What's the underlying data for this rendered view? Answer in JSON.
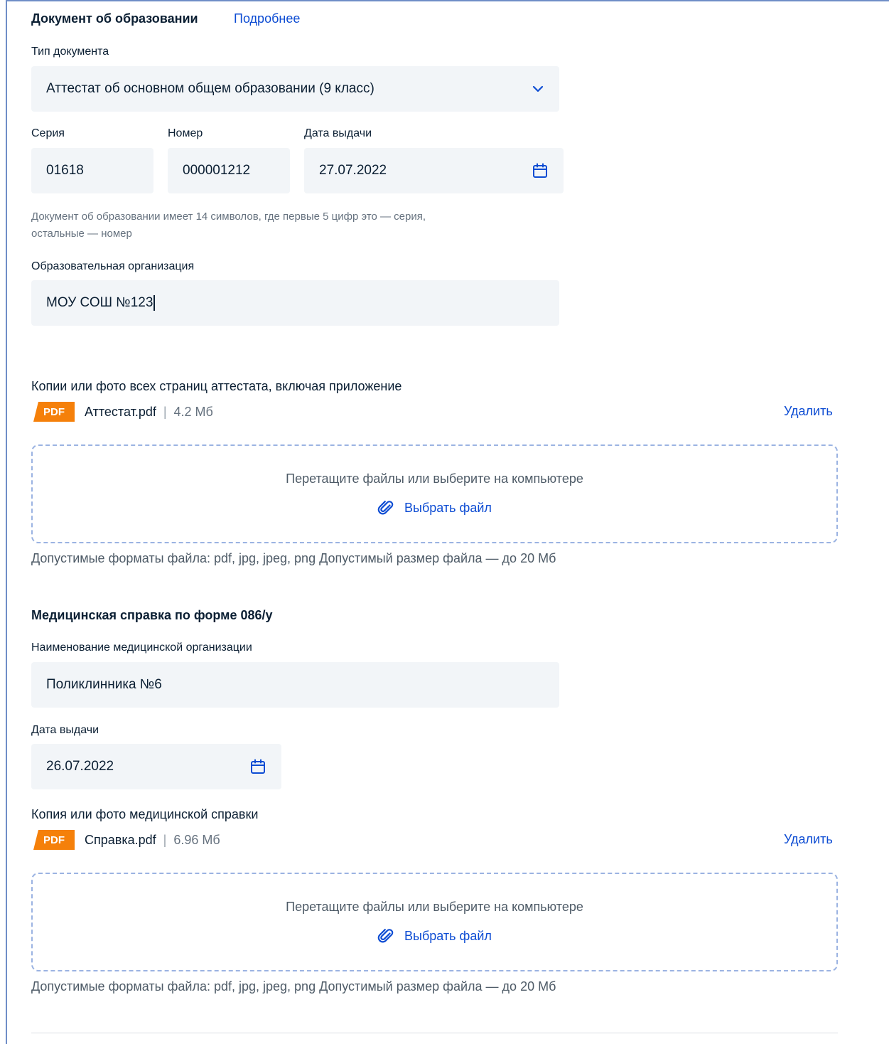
{
  "edu": {
    "title": "Документ об образовании",
    "more_link": "Подробнее",
    "doc_type_label": "Тип документа",
    "doc_type_value": "Аттестат об основном общем образовании (9 класс)",
    "series_label": "Серия",
    "series_value": "01618",
    "number_label": "Номер",
    "number_value": "000001212",
    "issue_date_label": "Дата выдачи",
    "issue_date_value": "27.07.2022",
    "hint_line1": "Документ об образовании имеет 14 символов, где первые 5 цифр это — серия,",
    "hint_line2": "остальные — номер",
    "org_label": "Образовательная организация",
    "org_value": "МОУ СОШ №123",
    "copies_label": "Копии или фото всех страниц аттестата, включая приложение",
    "file": {
      "badge": "PDF",
      "name": "Аттестат.pdf",
      "separator": "|",
      "size": "4.2 Мб",
      "delete": "Удалить"
    },
    "dropzone": {
      "text": "Перетащите файлы или выберите на компьютере",
      "choose": "Выбрать файл"
    },
    "formats": "Допустимые форматы файла: pdf, jpg, jpeg, png Допустимый размер файла — до 20 Мб"
  },
  "med": {
    "title": "Медицинская справка по форме 086/у",
    "org_label": "Наименование медицинской организации",
    "org_value": "Поликлинника №6",
    "issue_date_label": "Дата выдачи",
    "issue_date_value": "26.07.2022",
    "copy_label": "Копия или фото медицинской справки",
    "file": {
      "badge": "PDF",
      "name": "Справка.pdf",
      "separator": "|",
      "size": "6.96 Мб",
      "delete": "Удалить"
    },
    "dropzone": {
      "text": "Перетащите файлы или выберите на компьютере",
      "choose": "Выбрать файл"
    },
    "formats": "Допустимые форматы файла: pdf, jpg, jpeg, png Допустимый размер файла — до 20 Мб"
  },
  "colors": {
    "accent": "#0d4cd3",
    "badge": "#f5800a",
    "field_bg": "#f2f5f8",
    "dropzone_border": "#9bb3e2"
  }
}
